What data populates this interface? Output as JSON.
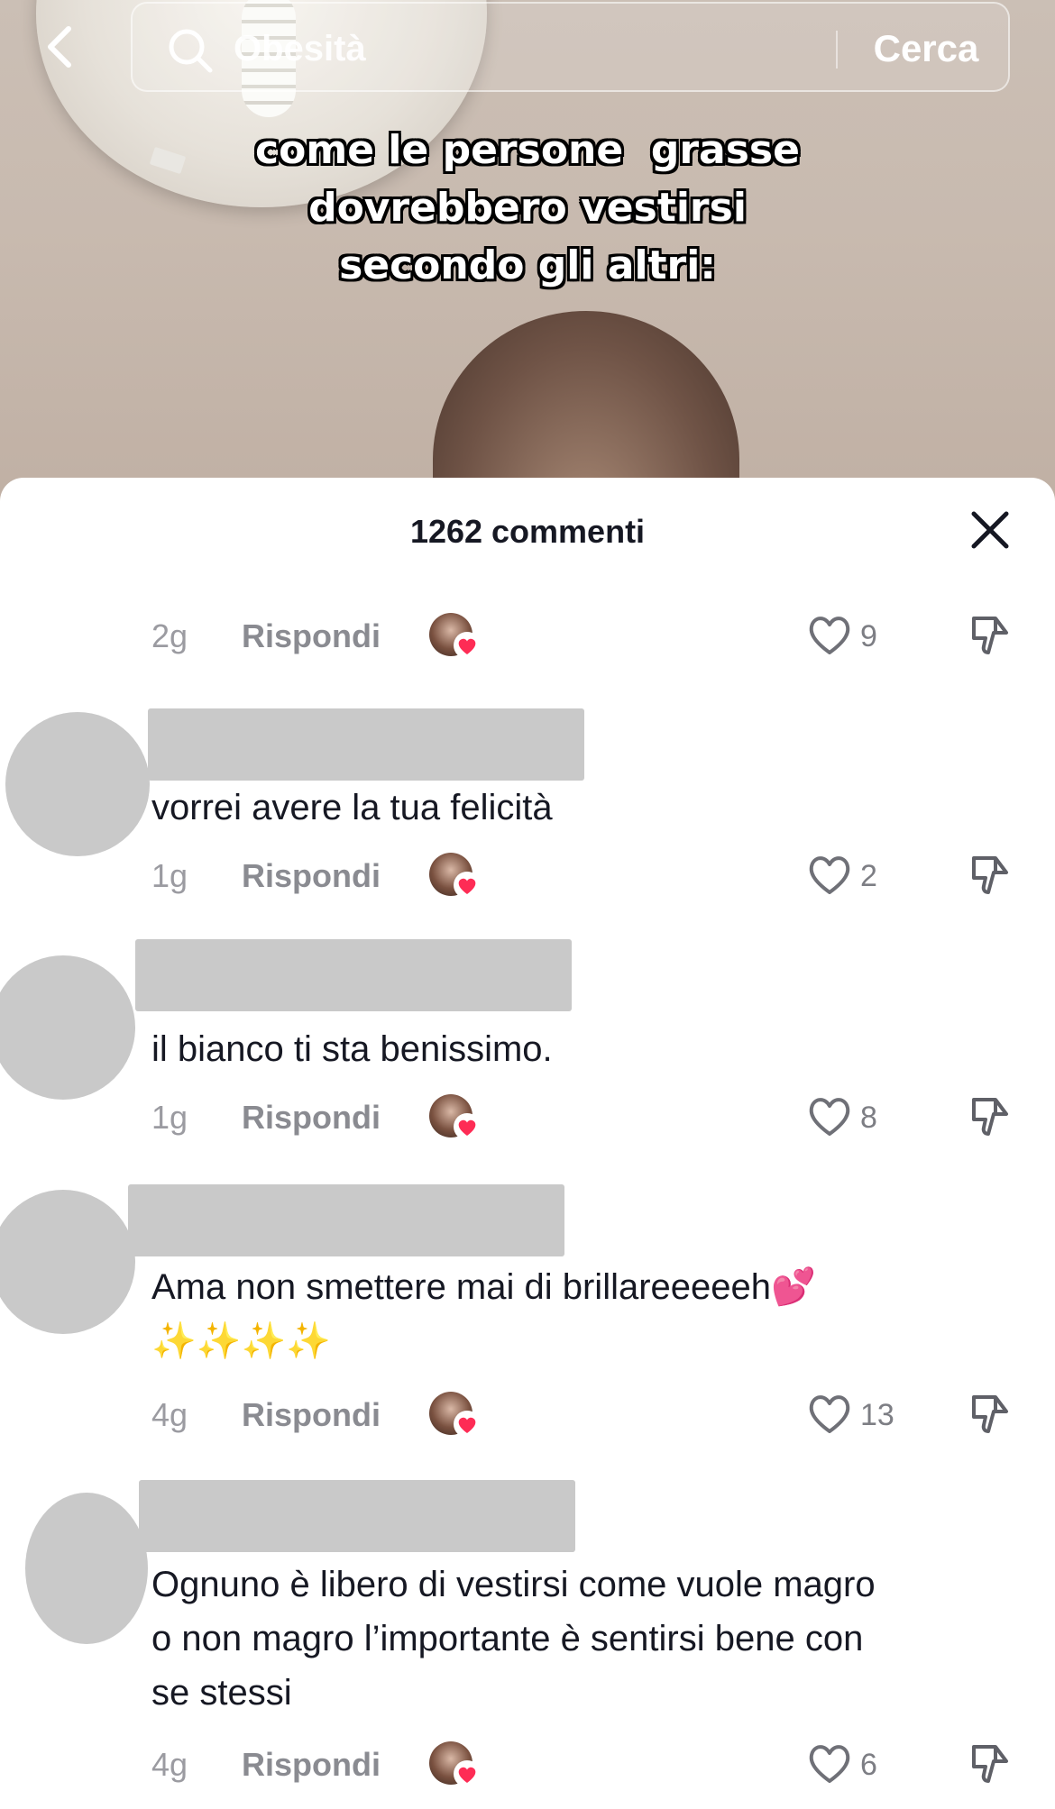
{
  "search": {
    "query": "Obesità",
    "button_label": "Cerca"
  },
  "video": {
    "overlay_lines": [
      "come le persone  grasse",
      "dovrebbero vestirsi",
      "secondo gli altri:"
    ]
  },
  "comments_sheet": {
    "title": "1262 commenti",
    "reply_label": "Rispondi",
    "comments": [
      {
        "text": "",
        "time": "2g",
        "likes": "9"
      },
      {
        "text": "vorrei avere la tua felicità",
        "time": "1g",
        "likes": "2"
      },
      {
        "text": "il bianco ti sta benissimo.",
        "time": "1g",
        "likes": "8"
      },
      {
        "text": "Ama non smettere mai di brillareeeeeh💕\n✨✨✨✨",
        "time": "4g",
        "likes": "13"
      },
      {
        "text": "Ognuno è libero di vestirsi come vuole magro\no non magro l’importante è sentirsi bene con\nse stessi",
        "time": "4g",
        "likes": "6"
      }
    ]
  },
  "colors": {
    "accent_heart": "#fe2c55",
    "placeholder_gray": "#c9c9c9"
  }
}
